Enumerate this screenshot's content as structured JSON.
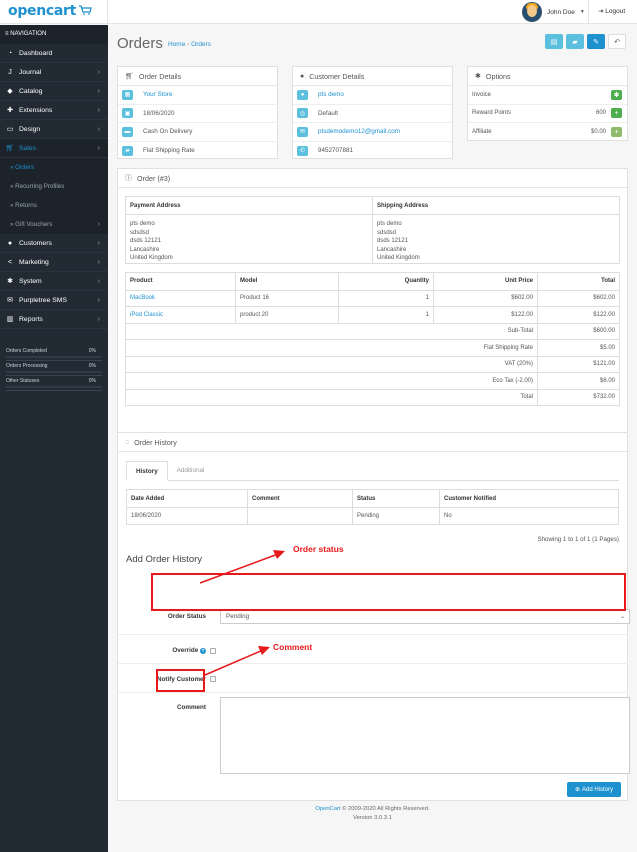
{
  "header": {
    "logo_text": "opencart",
    "user_name": "John Doe",
    "logout_label": "Logout"
  },
  "sidebar": {
    "nav_heading": "NAVIGATION",
    "items": [
      {
        "label": "Dashboard",
        "icon": "dashboard-icon"
      },
      {
        "label": "Journal",
        "icon": "journal-icon"
      },
      {
        "label": "Catalog",
        "icon": "tag-icon"
      },
      {
        "label": "Extensions",
        "icon": "puzzle-icon"
      },
      {
        "label": "Design",
        "icon": "monitor-icon"
      },
      {
        "label": "Sales",
        "icon": "cart-icon"
      }
    ],
    "sales_sub": [
      {
        "label": "Orders"
      },
      {
        "label": "Recurring Profiles"
      },
      {
        "label": "Returns"
      },
      {
        "label": "Gift Vouchers"
      }
    ],
    "items_after": [
      {
        "label": "Customers",
        "icon": "user-icon"
      },
      {
        "label": "Marketing",
        "icon": "share-icon"
      },
      {
        "label": "System",
        "icon": "cog-icon"
      },
      {
        "label": "Purpletree SMS",
        "icon": "envelope-icon"
      },
      {
        "label": "Reports",
        "icon": "bar-chart-icon"
      }
    ],
    "stats": [
      {
        "label": "Orders Completed",
        "pct": "0%",
        "fill": 0
      },
      {
        "label": "Orders Processing",
        "pct": "0%",
        "fill": 0
      },
      {
        "label": "Other Statuses",
        "pct": "0%",
        "fill": 0
      }
    ]
  },
  "page": {
    "title": "Orders",
    "breadcrumb_home": "Home",
    "breadcrumb_sep": "›",
    "breadcrumb_current": "Orders"
  },
  "order_details": {
    "heading": "Order Details",
    "store": "Your Store",
    "date": "18/06/2020",
    "payment": "Cash On Delivery",
    "shipping": "Flat Shipping Rate"
  },
  "customer_details": {
    "heading": "Customer Details",
    "name": "pts demo",
    "group": "Default",
    "email": "ptsdemodemo12@gmail.com",
    "phone": "9452707881"
  },
  "options": {
    "heading": "Options",
    "rows": [
      {
        "label": "Invoice",
        "value": ""
      },
      {
        "label": "Reward Points",
        "value": "600"
      },
      {
        "label": "Affiliate",
        "value": "$0.00"
      }
    ]
  },
  "order": {
    "heading": "Order (#3)",
    "payment_address_label": "Payment Address",
    "shipping_address_label": "Shipping Address",
    "payment_address": [
      "pts demo",
      "sdsdsd",
      "dsds 12121",
      "Lancashire",
      "United Kingdom"
    ],
    "shipping_address": [
      "pts demo",
      "sdsdsd",
      "dsds 12121",
      "Lancashire",
      "United Kingdom"
    ],
    "product_headers": {
      "product": "Product",
      "model": "Model",
      "quantity": "Quantity",
      "unit_price": "Unit Price",
      "total": "Total"
    },
    "products": [
      {
        "product": "MacBook",
        "model": "Product 16",
        "quantity": "1",
        "unit_price": "$602.00",
        "total": "$602.00"
      },
      {
        "product": "iPod Classic",
        "model": "product 20",
        "quantity": "1",
        "unit_price": "$122.00",
        "total": "$122.00"
      }
    ],
    "totals": [
      {
        "label": "Sub-Total",
        "value": "$600.00"
      },
      {
        "label": "Flat Shipping Rate",
        "value": "$5.00"
      },
      {
        "label": "VAT (20%)",
        "value": "$121.00"
      },
      {
        "label": "Eco Tax (-2.00)",
        "value": "$6.00"
      },
      {
        "label": "Total",
        "value": "$732.00"
      }
    ]
  },
  "history": {
    "heading": "Order History",
    "tab_history": "History",
    "tab_additional": "Additional",
    "headers": {
      "date": "Date Added",
      "comment": "Comment",
      "status": "Status",
      "notified": "Customer Notified"
    },
    "rows": [
      {
        "date": "18/06/2020",
        "comment": "",
        "status": "Pending",
        "notified": "No"
      }
    ],
    "pagination": "Showing 1 to 1 of 1 (1 Pages)",
    "add_heading": "Add Order History",
    "order_status_label": "Order Status",
    "order_status_value": "Pending",
    "override_label": "Override",
    "notify_label": "Notify Customer",
    "comment_label": "Comment",
    "add_button": "Add History"
  },
  "annotations": {
    "order_status": "Order status",
    "comment": "Comment",
    "color": "#e8191b"
  },
  "footer": {
    "link": "OpenCart",
    "text": " © 2009-2020 All Rights Reserved.",
    "version": "Version 3.0.3.1"
  },
  "colors": {
    "accent": "#1e91cf",
    "sidebar_bg": "#222b34",
    "info": "#5bc0de",
    "success": "#8fbb6c"
  }
}
